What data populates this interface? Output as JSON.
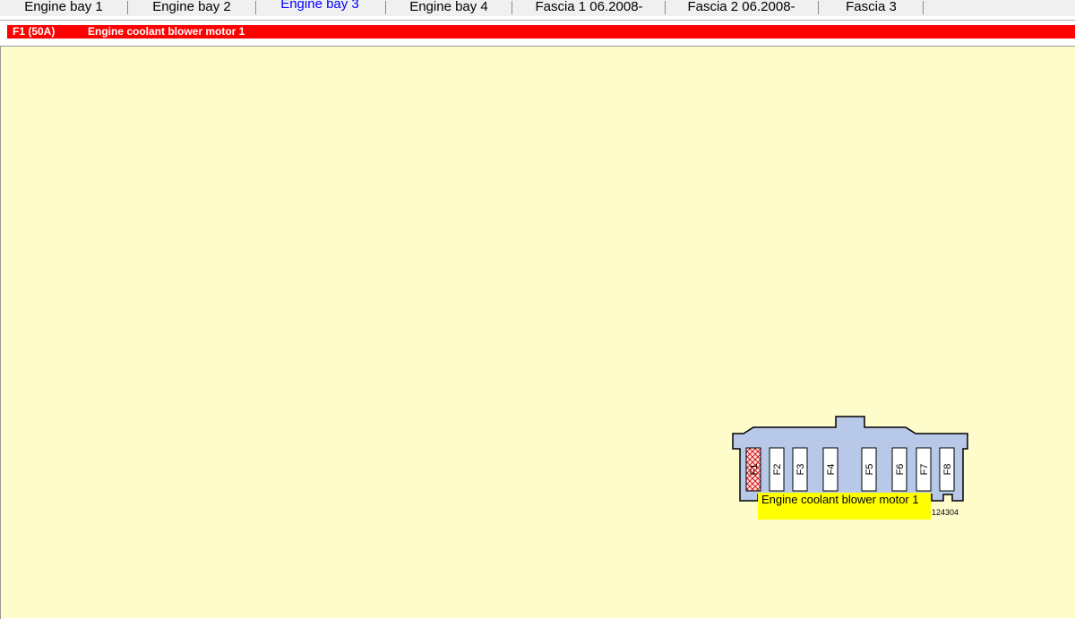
{
  "tabs": [
    {
      "label": "Engine bay 1",
      "active": false
    },
    {
      "label": "Engine bay 2",
      "active": false
    },
    {
      "label": "Engine bay 3",
      "active": true
    },
    {
      "label": "Engine bay 4",
      "active": false
    },
    {
      "label": "Fascia 1 06.2008-",
      "active": false
    },
    {
      "label": "Fascia 2 06.2008-",
      "active": false
    },
    {
      "label": "Fascia 3",
      "active": false
    }
  ],
  "info_bar": {
    "fuse_id": "F1 (50A)",
    "description": "Engine coolant blower motor 1",
    "color": "#ff0000"
  },
  "fusebox": {
    "fuses": [
      "F1",
      "F2",
      "F3",
      "F4",
      "F5",
      "F6",
      "F7",
      "F8"
    ],
    "highlighted_fuse": "F1",
    "body_color": "#b8c8e8",
    "callout_text": "Engine coolant blower motor 1",
    "callout_color": "#ffff00",
    "part_number": "124304"
  },
  "colors": {
    "background": "#fffccc",
    "active_tab": "#0000ff"
  }
}
